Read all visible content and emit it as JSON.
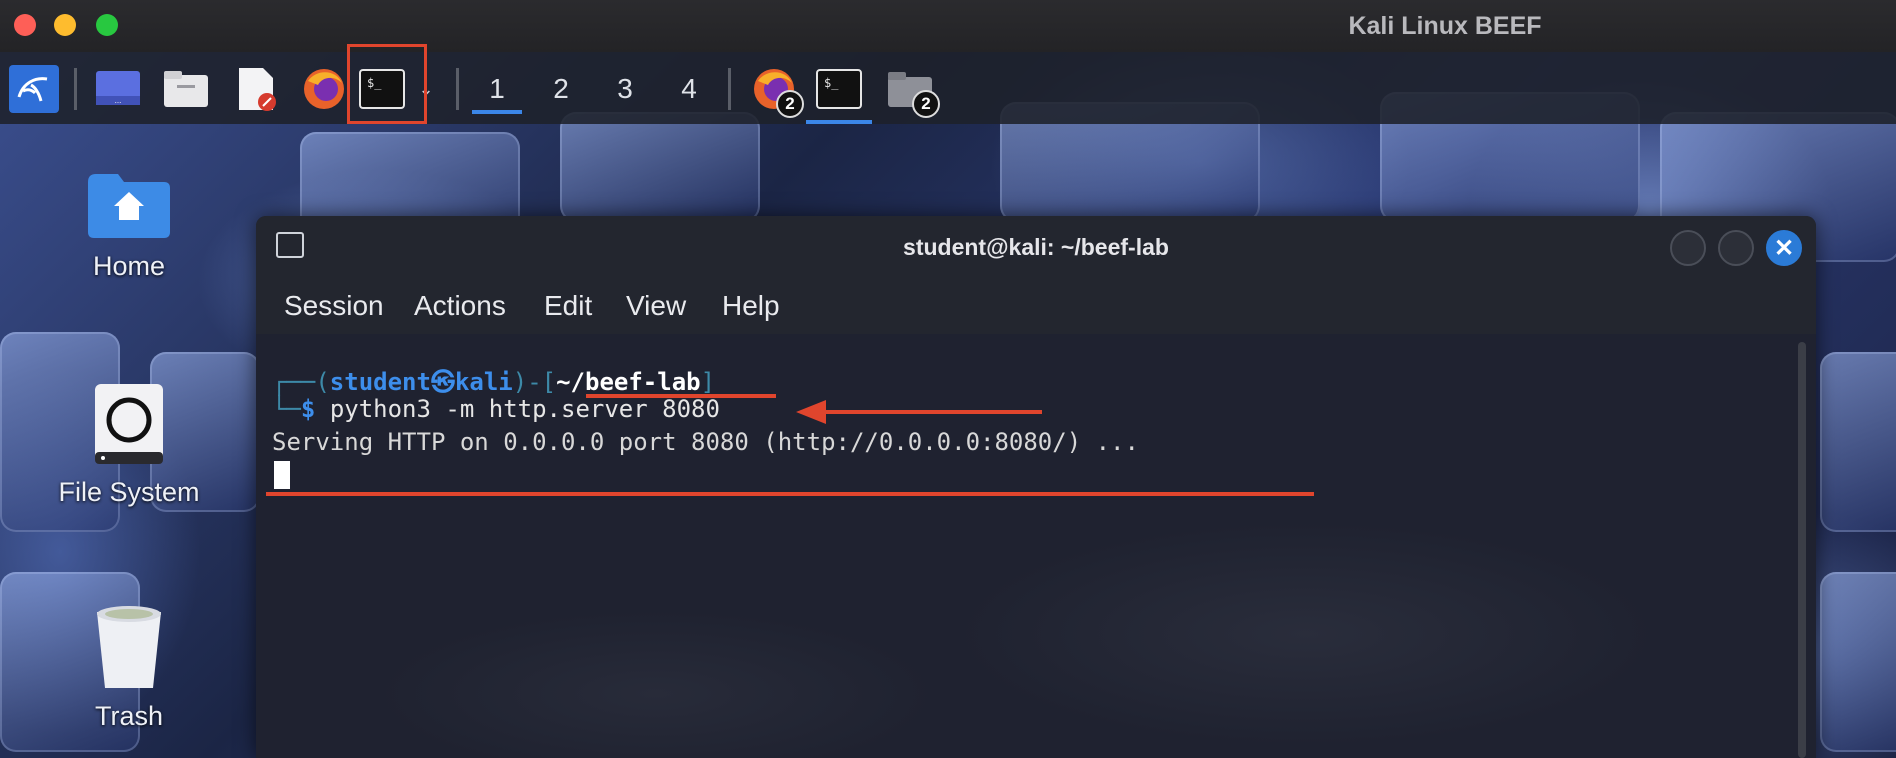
{
  "window": {
    "title": "Kali Linux BEEF"
  },
  "taskbar": {
    "workspaces": [
      "1",
      "2",
      "3",
      "4"
    ],
    "active_workspace": "1",
    "app_icons": [
      "kali-menu-icon",
      "desktop-icon",
      "file-manager-icon",
      "text-editor-icon",
      "firefox-icon",
      "terminal-icon"
    ],
    "running": [
      {
        "icon": "firefox-icon",
        "count": "2"
      },
      {
        "icon": "terminal-icon",
        "count": ""
      },
      {
        "icon": "folder-icon",
        "count": "2"
      }
    ]
  },
  "desktop": {
    "icons": [
      {
        "label": "Home",
        "icon": "home-icon"
      },
      {
        "label": "File System",
        "icon": "drive-icon"
      },
      {
        "label": "Trash",
        "icon": "trash-icon"
      }
    ]
  },
  "terminal": {
    "title": "student@kali: ~/beef-lab",
    "menu": [
      "Session",
      "Actions",
      "Edit",
      "View",
      "Help"
    ],
    "prompt": {
      "frame_top": "┌──(",
      "user": "student㉿kali",
      "mid": ")-[",
      "dir": "~/beef-lab",
      "end": "]",
      "frame_bottom": "└─",
      "dollar": "$"
    },
    "command": "python3 -m http.server 8080",
    "output": "Serving HTTP on 0.0.0.0 port 8080 (http://0.0.0.0:8080/) ..."
  },
  "colors": {
    "annotation": "#e0452d",
    "accent": "#3b86e8",
    "prompt_user": "#3d8eeb"
  }
}
